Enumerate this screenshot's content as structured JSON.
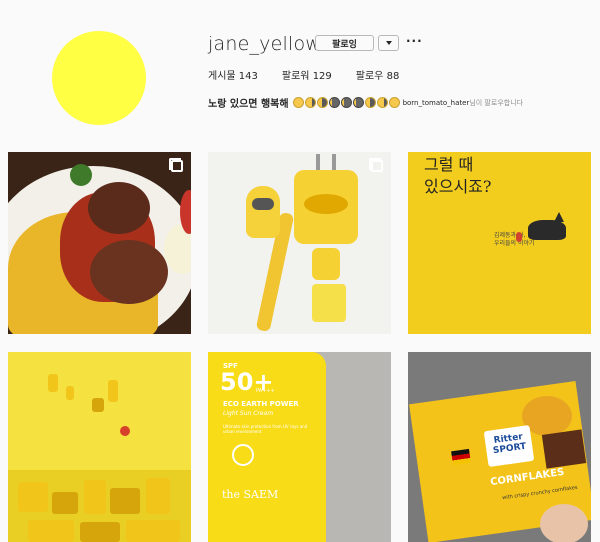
{
  "profile": {
    "username": "jane_yellow",
    "follow_label": "팔로잉",
    "more_label": "···",
    "avatar_color": "#ffff44",
    "stats": [
      {
        "label": "게시물",
        "value": "143"
      },
      {
        "label": "팔로워",
        "value": "129"
      },
      {
        "label": "팔로우",
        "value": "88"
      }
    ],
    "bio": "노랑 있으면 행복해",
    "mutual_name": "born_tomato_hater",
    "mutual_suffix": "님이 팔로우합니다"
  },
  "posts": {
    "book_title_line1": "그럴 때",
    "book_title_line2": "있으시죠?",
    "book_sub_line1": "김제동과 나,",
    "book_sub_line2": "우리들의 이야기",
    "sunscreen_spf": "SPF",
    "sunscreen_num": "50+",
    "sunscreen_pa": "PA+++",
    "sunscreen_name": "ECO EARTH POWER",
    "sunscreen_sub": "Light Sun Cream",
    "sunscreen_desc": "Ultimate skin protection from UV rays and urban environment",
    "sunscreen_brand": "the SAEM",
    "choc_logo_1": "Ritter",
    "choc_logo_2": "SPORT",
    "choc_name": "CORNFLAKES",
    "choc_tagline": "with crispy crunchy cornflakes"
  },
  "colors": {
    "accent_yellow": "#f6d133",
    "text": "#262626",
    "muted": "#8e8e8e"
  }
}
